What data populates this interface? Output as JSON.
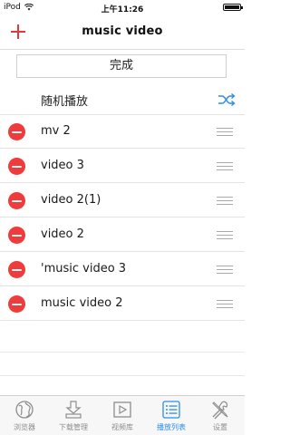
{
  "status_bar": {
    "carrier": "iPod",
    "time": "上午11:26"
  },
  "nav": {
    "title": "music video",
    "add_icon": "plus-icon"
  },
  "done_label": "完成",
  "shuffle": {
    "label": "随机播放",
    "icon": "shuffle-icon"
  },
  "playlist": {
    "items": [
      {
        "title": "mv 2"
      },
      {
        "title": "video 3"
      },
      {
        "title": "video 2(1)"
      },
      {
        "title": "video 2"
      },
      {
        "title": "'music video 3"
      },
      {
        "title": "music video 2"
      }
    ]
  },
  "tab_bar": {
    "tabs": [
      {
        "label": "浏览器",
        "icon": "globe-icon"
      },
      {
        "label": "下载管理",
        "icon": "download-icon"
      },
      {
        "label": "视频库",
        "icon": "play-icon"
      },
      {
        "label": "播放列表",
        "icon": "list-icon",
        "active": true
      },
      {
        "label": "设置",
        "icon": "tools-icon"
      }
    ]
  },
  "colors": {
    "accent": "#2a8ee8",
    "delete": "#ef3b3b",
    "add": "#e0393e"
  }
}
